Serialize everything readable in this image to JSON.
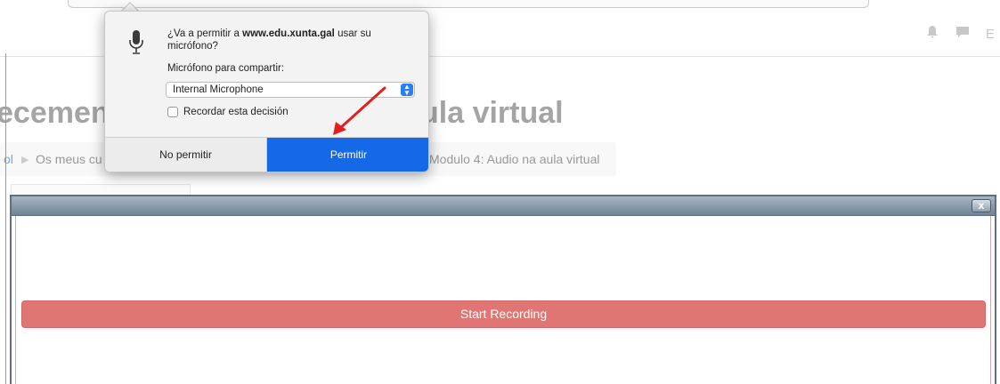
{
  "page": {
    "heading_left": "ecemen",
    "heading_right": "ula virtual",
    "breadcrumb": {
      "first": "ol",
      "second": "Os meus cu",
      "last": "Modulo 4: Audio na aula virtual"
    },
    "topbar_edge_text": "E"
  },
  "permission_popover": {
    "prompt_prefix": "¿Va a permitir a ",
    "domain": "www.edu.xunta.gal",
    "prompt_suffix": " usar su micrófono?",
    "share_label": "Micrófono para compartir:",
    "selected_microphone": "Internal Microphone",
    "remember_label": "Recordar esta decisión",
    "remember_checked": false,
    "deny_label": "No permitir",
    "allow_label": "Permitir",
    "allow_color": "#1569e6"
  },
  "recording_dialog": {
    "close_label": "x",
    "start_recording_label": "Start Recording",
    "button_color": "#e07673"
  },
  "annotation": {
    "arrow_color": "#e02020"
  }
}
